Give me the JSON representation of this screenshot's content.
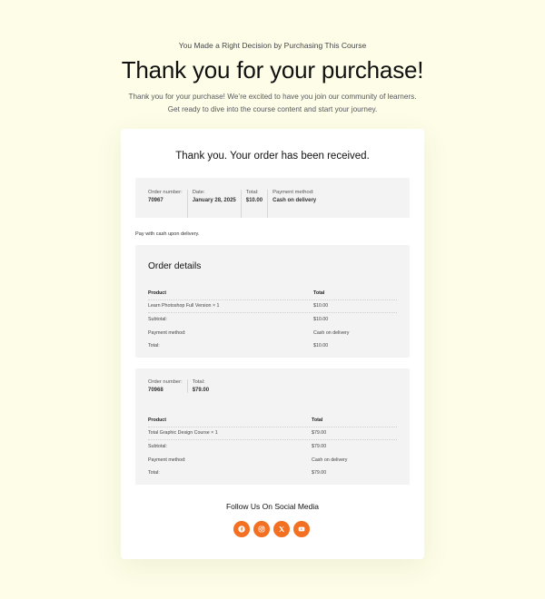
{
  "header": {
    "eyebrow": "You Made a Right Decision by Purchasing This Course",
    "title": "Thank you for your purchase!",
    "subtitle_line1": "Thank you for your purchase! We’re excited to have you join our community of learners.",
    "subtitle_line2": "Get ready to dive into the course content and start your journey."
  },
  "order": {
    "received_title": "Thank you. Your order has been received.",
    "overview": [
      {
        "label": "Order number:",
        "value": "70967"
      },
      {
        "label": "Date:",
        "value": "January 28, 2025"
      },
      {
        "label": "Total:",
        "value": "$10.00"
      },
      {
        "label": "Payment method:",
        "value": "Cash on delivery"
      }
    ],
    "payment_note": "Pay with cash upon delivery."
  },
  "details": {
    "heading": "Order details",
    "columns": [
      "Product",
      "Total"
    ],
    "item": {
      "product": "Learn Photoshop Full Version × 1",
      "total": "$10.00"
    },
    "rows": [
      {
        "label": "Subtotal:",
        "value": "$10.00"
      },
      {
        "label": "Payment method:",
        "value": "Cash on delivery"
      },
      {
        "label": "Total:",
        "value": "$10.00"
      }
    ]
  },
  "second_order": {
    "overview": [
      {
        "label": "Order number:",
        "value": "70968"
      },
      {
        "label": "Total:",
        "value": "$79.00"
      }
    ],
    "columns": [
      "Product",
      "Total"
    ],
    "item": {
      "product": "Total Graphic Design Course × 1",
      "total": "$79.00"
    },
    "rows": [
      {
        "label": "Subtotal:",
        "value": "$79.00"
      },
      {
        "label": "Payment method:",
        "value": "Cash on delivery"
      },
      {
        "label": "Total:",
        "value": "$79.00"
      }
    ]
  },
  "social": {
    "title": "Follow Us On Social Media",
    "icons": [
      "facebook-icon",
      "instagram-icon",
      "x-icon",
      "youtube-icon"
    ],
    "accent": "#f36f21"
  }
}
